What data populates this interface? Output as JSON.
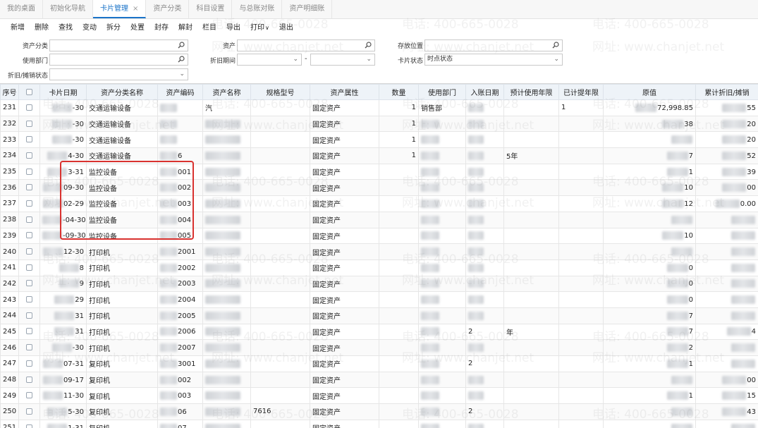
{
  "tabs": [
    {
      "label": "我的桌面",
      "active": false
    },
    {
      "label": "初始化导航",
      "active": false
    },
    {
      "label": "卡片管理",
      "active": true
    },
    {
      "label": "资产分类",
      "active": false
    },
    {
      "label": "科目设置",
      "active": false
    },
    {
      "label": "与总账对账",
      "active": false
    },
    {
      "label": "资产明细账",
      "active": false
    }
  ],
  "tab_close": "×",
  "toolbar": [
    "新增",
    "删除",
    "查找",
    "变动",
    "拆分",
    "处置",
    "封存",
    "解封",
    "栏目",
    "导出",
    "打印",
    "退出"
  ],
  "print_caret": "∨",
  "form": {
    "asset_category_label": "资产分类",
    "asset_label": "资产",
    "location_label": "存放位置",
    "department_label": "使用部门",
    "period_label": "折旧期间",
    "period_dash": "-",
    "card_status_label": "卡片状态",
    "card_status_value": "时点状态",
    "disposal_label": "折旧/摊销状态"
  },
  "watermark": {
    "phone": "电话: 400-665-0028",
    "site": "网址: www.chanjet.net"
  },
  "columns": [
    "序号",
    "",
    "卡片日期",
    "资产分类名称",
    "资产编码",
    "资产名称",
    "规格型号",
    "资产属性",
    "数量",
    "使用部门",
    "入账日期",
    "预计使用年限",
    "已计提年限",
    "原值",
    "累计折旧/摊销"
  ],
  "rows": [
    {
      "seq": "231",
      "date": "-30",
      "category": "交通运输设备",
      "code": "",
      "name": "汽",
      "spec": "",
      "attr": "固定资产",
      "qty": "1",
      "dept": "销售部",
      "entry": "",
      "life": "",
      "used": "1",
      "orig": "72,998.85",
      "acc": "55"
    },
    {
      "seq": "232",
      "date": "-30",
      "category": "交通运输设备",
      "code": "",
      "name": "",
      "spec": "",
      "attr": "固定资产",
      "qty": "1",
      "dept": "",
      "entry": "",
      "life": "",
      "used": "",
      "orig": "38",
      "acc": "20"
    },
    {
      "seq": "233",
      "date": "-30",
      "category": "交通运输设备",
      "code": "",
      "name": "",
      "spec": "",
      "attr": "固定资产",
      "qty": "1",
      "dept": "",
      "entry": "",
      "life": "",
      "used": "",
      "orig": "",
      "acc": "20"
    },
    {
      "seq": "234",
      "date": "4-30",
      "category": "交通运输设备",
      "code": "6",
      "name": "",
      "spec": "",
      "attr": "固定资产",
      "qty": "1",
      "dept": "",
      "entry": "",
      "life": "5年",
      "used": "",
      "orig": "7",
      "acc": "52"
    },
    {
      "seq": "235",
      "date": "3-31",
      "category": "监控设备",
      "code": "001",
      "name": "",
      "spec": "",
      "attr": "固定资产",
      "qty": "",
      "dept": "",
      "entry": "",
      "life": "",
      "used": "",
      "orig": "1",
      "acc": "39"
    },
    {
      "seq": "236",
      "date": "09-30",
      "category": "监控设备",
      "code": "002",
      "name": "",
      "spec": "",
      "attr": "固定资产",
      "qty": "",
      "dept": "",
      "entry": "",
      "life": "",
      "used": "",
      "orig": "10",
      "acc": "00"
    },
    {
      "seq": "237",
      "date": "02-29",
      "category": "监控设备",
      "code": "003",
      "name": "",
      "spec": "",
      "attr": "固定资产",
      "qty": "",
      "dept": "",
      "entry": "",
      "life": "",
      "used": "",
      "orig": "12",
      "acc": "0.00"
    },
    {
      "seq": "238",
      "date": "-04-30",
      "category": "监控设备",
      "code": "004",
      "name": "",
      "spec": "",
      "attr": "固定资产",
      "qty": "",
      "dept": "",
      "entry": "",
      "life": "",
      "used": "",
      "orig": "",
      "acc": ""
    },
    {
      "seq": "239",
      "date": "-09-30",
      "category": "监控设备",
      "code": "005",
      "name": "",
      "spec": "",
      "attr": "固定资产",
      "qty": "",
      "dept": "",
      "entry": "",
      "life": "",
      "used": "",
      "orig": "10",
      "acc": ""
    },
    {
      "seq": "240",
      "date": "12-30",
      "category": "打印机",
      "code": "2001",
      "name": "",
      "spec": "",
      "attr": "固定资产",
      "qty": "",
      "dept": "",
      "entry": "",
      "life": "",
      "used": "",
      "orig": "",
      "acc": ""
    },
    {
      "seq": "241",
      "date": "8",
      "category": "打印机",
      "code": "2002",
      "name": "",
      "spec": "",
      "attr": "固定资产",
      "qty": "",
      "dept": "",
      "entry": "",
      "life": "",
      "used": "",
      "orig": "0",
      "acc": ""
    },
    {
      "seq": "242",
      "date": "9",
      "category": "打印机",
      "code": "2003",
      "name": "",
      "spec": "",
      "attr": "固定资产",
      "qty": "",
      "dept": "",
      "entry": "",
      "life": "",
      "used": "",
      "orig": "0",
      "acc": ""
    },
    {
      "seq": "243",
      "date": "29",
      "category": "打印机",
      "code": "2004",
      "name": "",
      "spec": "",
      "attr": "固定资产",
      "qty": "",
      "dept": "",
      "entry": "",
      "life": "",
      "used": "",
      "orig": "0",
      "acc": ""
    },
    {
      "seq": "244",
      "date": "31",
      "category": "打印机",
      "code": "2005",
      "name": "",
      "spec": "",
      "attr": "固定资产",
      "qty": "",
      "dept": "",
      "entry": "",
      "life": "",
      "used": "",
      "orig": "7",
      "acc": ""
    },
    {
      "seq": "245",
      "date": "31",
      "category": "打印机",
      "code": "2006",
      "name": "",
      "spec": "",
      "attr": "固定资产",
      "qty": "",
      "dept": "",
      "entry": "2",
      "life": "年",
      "used": "",
      "orig": "7",
      "acc": "4"
    },
    {
      "seq": "246",
      "date": "-30",
      "category": "打印机",
      "code": "2007",
      "name": "",
      "spec": "",
      "attr": "固定资产",
      "qty": "",
      "dept": "",
      "entry": "",
      "life": "",
      "used": "",
      "orig": "2",
      "acc": ""
    },
    {
      "seq": "247",
      "date": "07-31",
      "category": "复印机",
      "code": "3001",
      "name": "",
      "spec": "",
      "attr": "固定资产",
      "qty": "",
      "dept": "",
      "entry": "2",
      "life": "",
      "used": "",
      "orig": "1",
      "acc": ""
    },
    {
      "seq": "248",
      "date": "09-17",
      "category": "复印机",
      "code": "002",
      "name": "",
      "spec": "",
      "attr": "固定资产",
      "qty": "",
      "dept": "",
      "entry": "",
      "life": "",
      "used": "",
      "orig": "",
      "acc": "00"
    },
    {
      "seq": "249",
      "date": "11-30",
      "category": "复印机",
      "code": "003",
      "name": "",
      "spec": "",
      "attr": "固定资产",
      "qty": "",
      "dept": "",
      "entry": "",
      "life": "",
      "used": "",
      "orig": "1",
      "acc": "15"
    },
    {
      "seq": "250",
      "date": "5-30",
      "category": "复印机",
      "code": "06",
      "name": "",
      "spec": "7616",
      "attr": "固定资产",
      "qty": "",
      "dept": "",
      "entry": "2",
      "life": "",
      "used": "",
      "orig": "",
      "acc": "43"
    },
    {
      "seq": "251",
      "date": "1-31",
      "category": "复印机",
      "code": "07",
      "name": "",
      "spec": "",
      "attr": "固定资产",
      "qty": "",
      "dept": "",
      "entry": "",
      "life": "",
      "used": "",
      "orig": "",
      "acc": ""
    }
  ]
}
